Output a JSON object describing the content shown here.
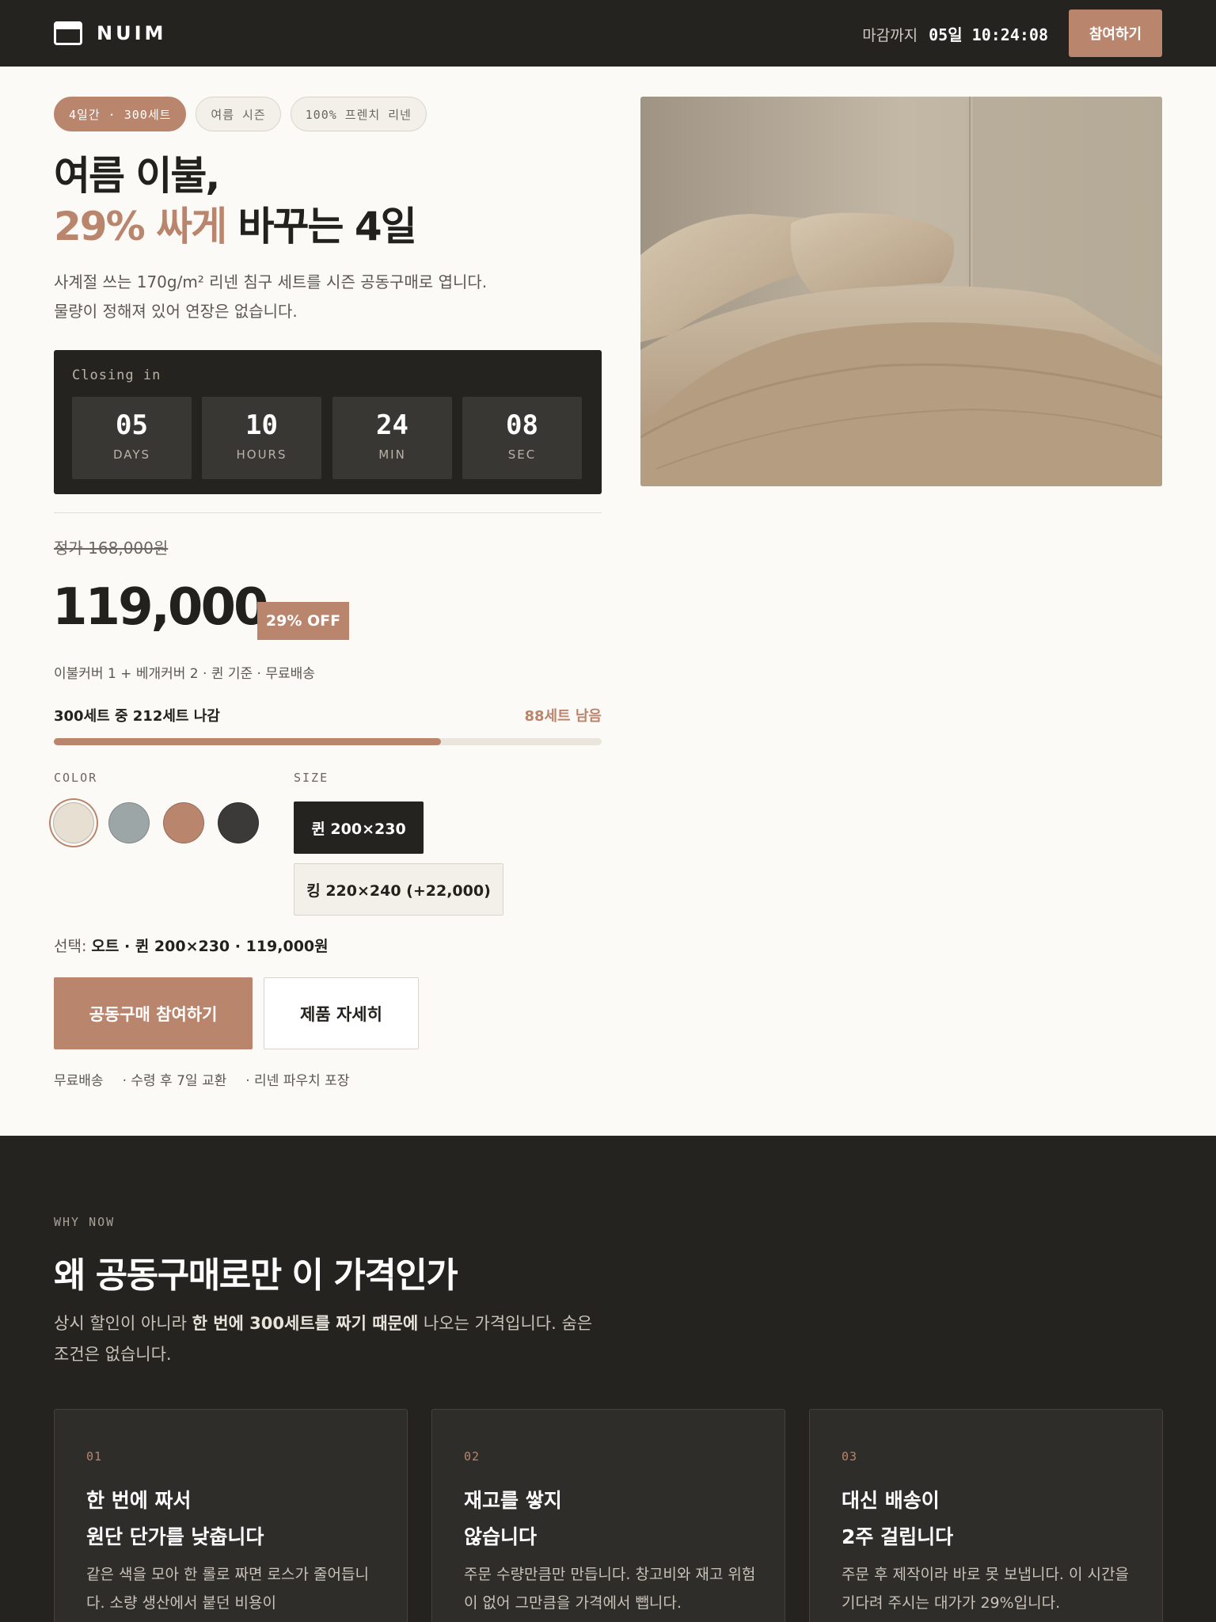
{
  "brand": {
    "name": "NUIM"
  },
  "topbar": {
    "deadline_label": "마감까지",
    "deadline_value": "05일 10:24:08",
    "cta_label": "참여하기"
  },
  "hero": {
    "chips": [
      "4일간 · 300세트",
      "여름 시즌",
      "100% 프렌치 리넨"
    ],
    "headline_line1": "여름 이불,",
    "headline_highlight": "29% 싸게",
    "headline_rest": " 바꾸는 4일",
    "subcopy_line1": "사계절 쓰는 170g/m² 리넨 침구 세트를 시즌 공동구매로 엽니다.",
    "subcopy_line2": "물량이 정해져 있어 연장은 없습니다."
  },
  "countdown": {
    "label": "Closing in",
    "units": [
      {
        "value": "05",
        "label": "DAYS"
      },
      {
        "value": "10",
        "label": "HOURS"
      },
      {
        "value": "24",
        "label": "MIN"
      },
      {
        "value": "08",
        "label": "SEC"
      }
    ]
  },
  "pricing": {
    "original": "정가 168,000원",
    "price": "119,000",
    "unit": "원",
    "discount": "29% OFF",
    "includes": "이불커버 1 + 베개커버 2 · 퀸 기준 · 무료배송"
  },
  "progress": {
    "label": "300세트 중 212세트 나감",
    "remaining": "88세트 남음",
    "sold": 212,
    "total": 300
  },
  "options": {
    "color_title": "COLOR",
    "size_title": "SIZE",
    "colors": [
      "#e6dfd2",
      "#9da6a6",
      "#b9856d",
      "#3b3a38"
    ],
    "selected_color_index": 0,
    "sizes": [
      "퀸 200×230",
      "킹 220×240 (+22,000)"
    ],
    "selected_size_index": 0
  },
  "selection": {
    "prefix": "선택: ",
    "value": "오트 · 퀸 200×230 · 119,000원"
  },
  "actions": {
    "primary": "공동구매 참여하기",
    "secondary": "제품 자세히"
  },
  "perks": [
    "무료배송",
    "· 수령 후 7일 교환",
    "· 리넨 파우치 포장"
  ],
  "why": {
    "eyebrow": "WHY NOW",
    "title": "왜 공동구매로만 이 가격인가",
    "sub_pre": "상시 할인이 아니라 ",
    "sub_bold": "한 번에 300세트를 짜기 때문에",
    "sub_post": " 나오는 가격입니다. 숨은 조건은 없습니다.",
    "cards": [
      {
        "no": "01",
        "title_line1": "한 번에 짜서",
        "title_line2": "원단 단가를 낮춥니다",
        "body": "같은 색을 모아 한 롤로 짜면 로스가 줄어듭니다. 소량 생산에서 붙던 비용이"
      },
      {
        "no": "02",
        "title_line1": "재고를 쌓지",
        "title_line2": "않습니다",
        "body": "주문 수량만큼만 만듭니다. 창고비와 재고 위험이 없어 그만큼을 가격에서 뺍니다."
      },
      {
        "no": "03",
        "title_line1": "대신 배송이",
        "title_line2": "2주 걸립니다",
        "body": "주문 후 제작이라 바로 못 보냅니다. 이 시간을 기다려 주시는 대가가 29%입니다."
      }
    ]
  }
}
